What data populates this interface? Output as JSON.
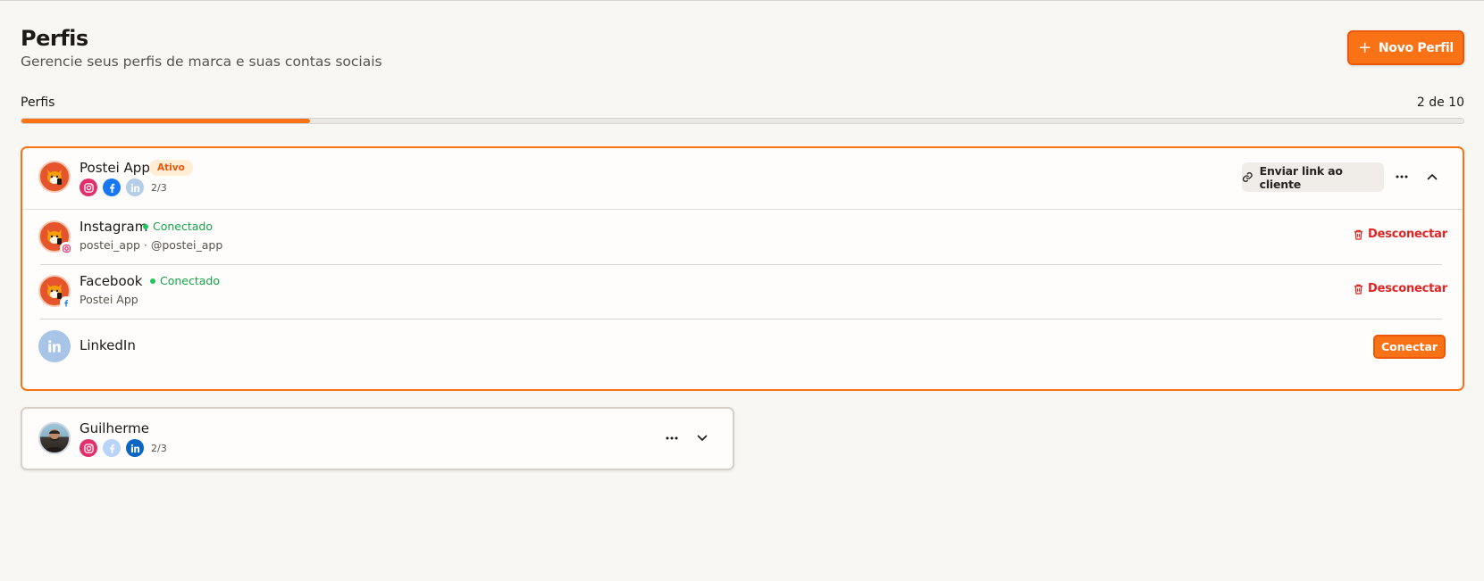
{
  "header": {
    "title": "Perfis",
    "subtitle": "Gerencie seus perfis de marca e suas contas sociais",
    "new_profile_label": "Novo Perfil"
  },
  "quota": {
    "label": "Perfis",
    "count_text": "2 de 10",
    "used": 2,
    "total": 10
  },
  "profiles": [
    {
      "name": "Postei App",
      "status_badge": "Ativo",
      "connected_count": "2/3",
      "networks": [
        "instagram",
        "facebook",
        "linkedin-disconnected"
      ],
      "send_link_label": "Enviar link ao cliente",
      "expanded": true,
      "accounts": [
        {
          "network": "Instagram",
          "status": "Conectado",
          "detail": "postei_app · @postei_app",
          "action": "Desconectar"
        },
        {
          "network": "Facebook",
          "status": "Conectado",
          "detail": "Postei App",
          "action": "Desconectar"
        },
        {
          "network": "LinkedIn",
          "status": "",
          "detail": "",
          "action": "Conectar"
        }
      ]
    },
    {
      "name": "Guilherme",
      "connected_count": "2/3",
      "networks": [
        "instagram",
        "facebook-disconnected",
        "linkedin"
      ],
      "expanded": false
    }
  ],
  "colors": {
    "accent": "#f97316",
    "connected": "#16a34a",
    "danger": "#dc2626",
    "instagram": "#e1306c",
    "facebook": "#1877f2",
    "linkedin": "#0a66c2"
  }
}
